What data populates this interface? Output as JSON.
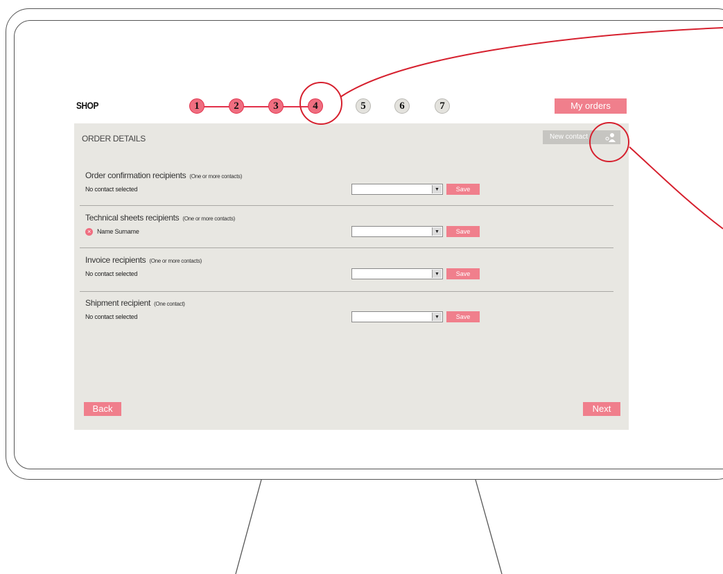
{
  "header": {
    "shop_label": "SHOP",
    "my_orders_label": "My orders"
  },
  "steps": [
    {
      "label": "1",
      "state": "completed"
    },
    {
      "label": "2",
      "state": "completed"
    },
    {
      "label": "3",
      "state": "completed"
    },
    {
      "label": "4",
      "state": "current"
    },
    {
      "label": "5",
      "state": "upcoming"
    },
    {
      "label": "6",
      "state": "upcoming"
    },
    {
      "label": "7",
      "state": "upcoming"
    }
  ],
  "panel": {
    "title": "ORDER DETAILS",
    "new_contact_label": "New contact",
    "new_contact_icon": "add-user-icon"
  },
  "sections": [
    {
      "title": "Order confirmation recipients",
      "note": "(One or more contacts)",
      "status": "No contact selected",
      "select_value": "",
      "save_label": "Save"
    },
    {
      "title": "Technical sheets recipients",
      "note": "(One or more contacts)",
      "status": "Name Surname",
      "status_icon": "remove-icon",
      "select_value": "",
      "save_label": "Save"
    },
    {
      "title": "Invoice recipients",
      "note": "(One or more contacts)",
      "status": "No contact selected",
      "select_value": "",
      "save_label": "Save"
    },
    {
      "title": "Shipment recipient",
      "note": "(One contact)",
      "status": "No contact selected",
      "select_value": "",
      "save_label": "Save"
    }
  ],
  "footer": {
    "back_label": "Back",
    "next_label": "Next"
  },
  "colors": {
    "accent": "#f07f8c",
    "accent_dark": "#e2304a",
    "panel_bg": "#e8e7e2",
    "callout": "#d6202e"
  }
}
